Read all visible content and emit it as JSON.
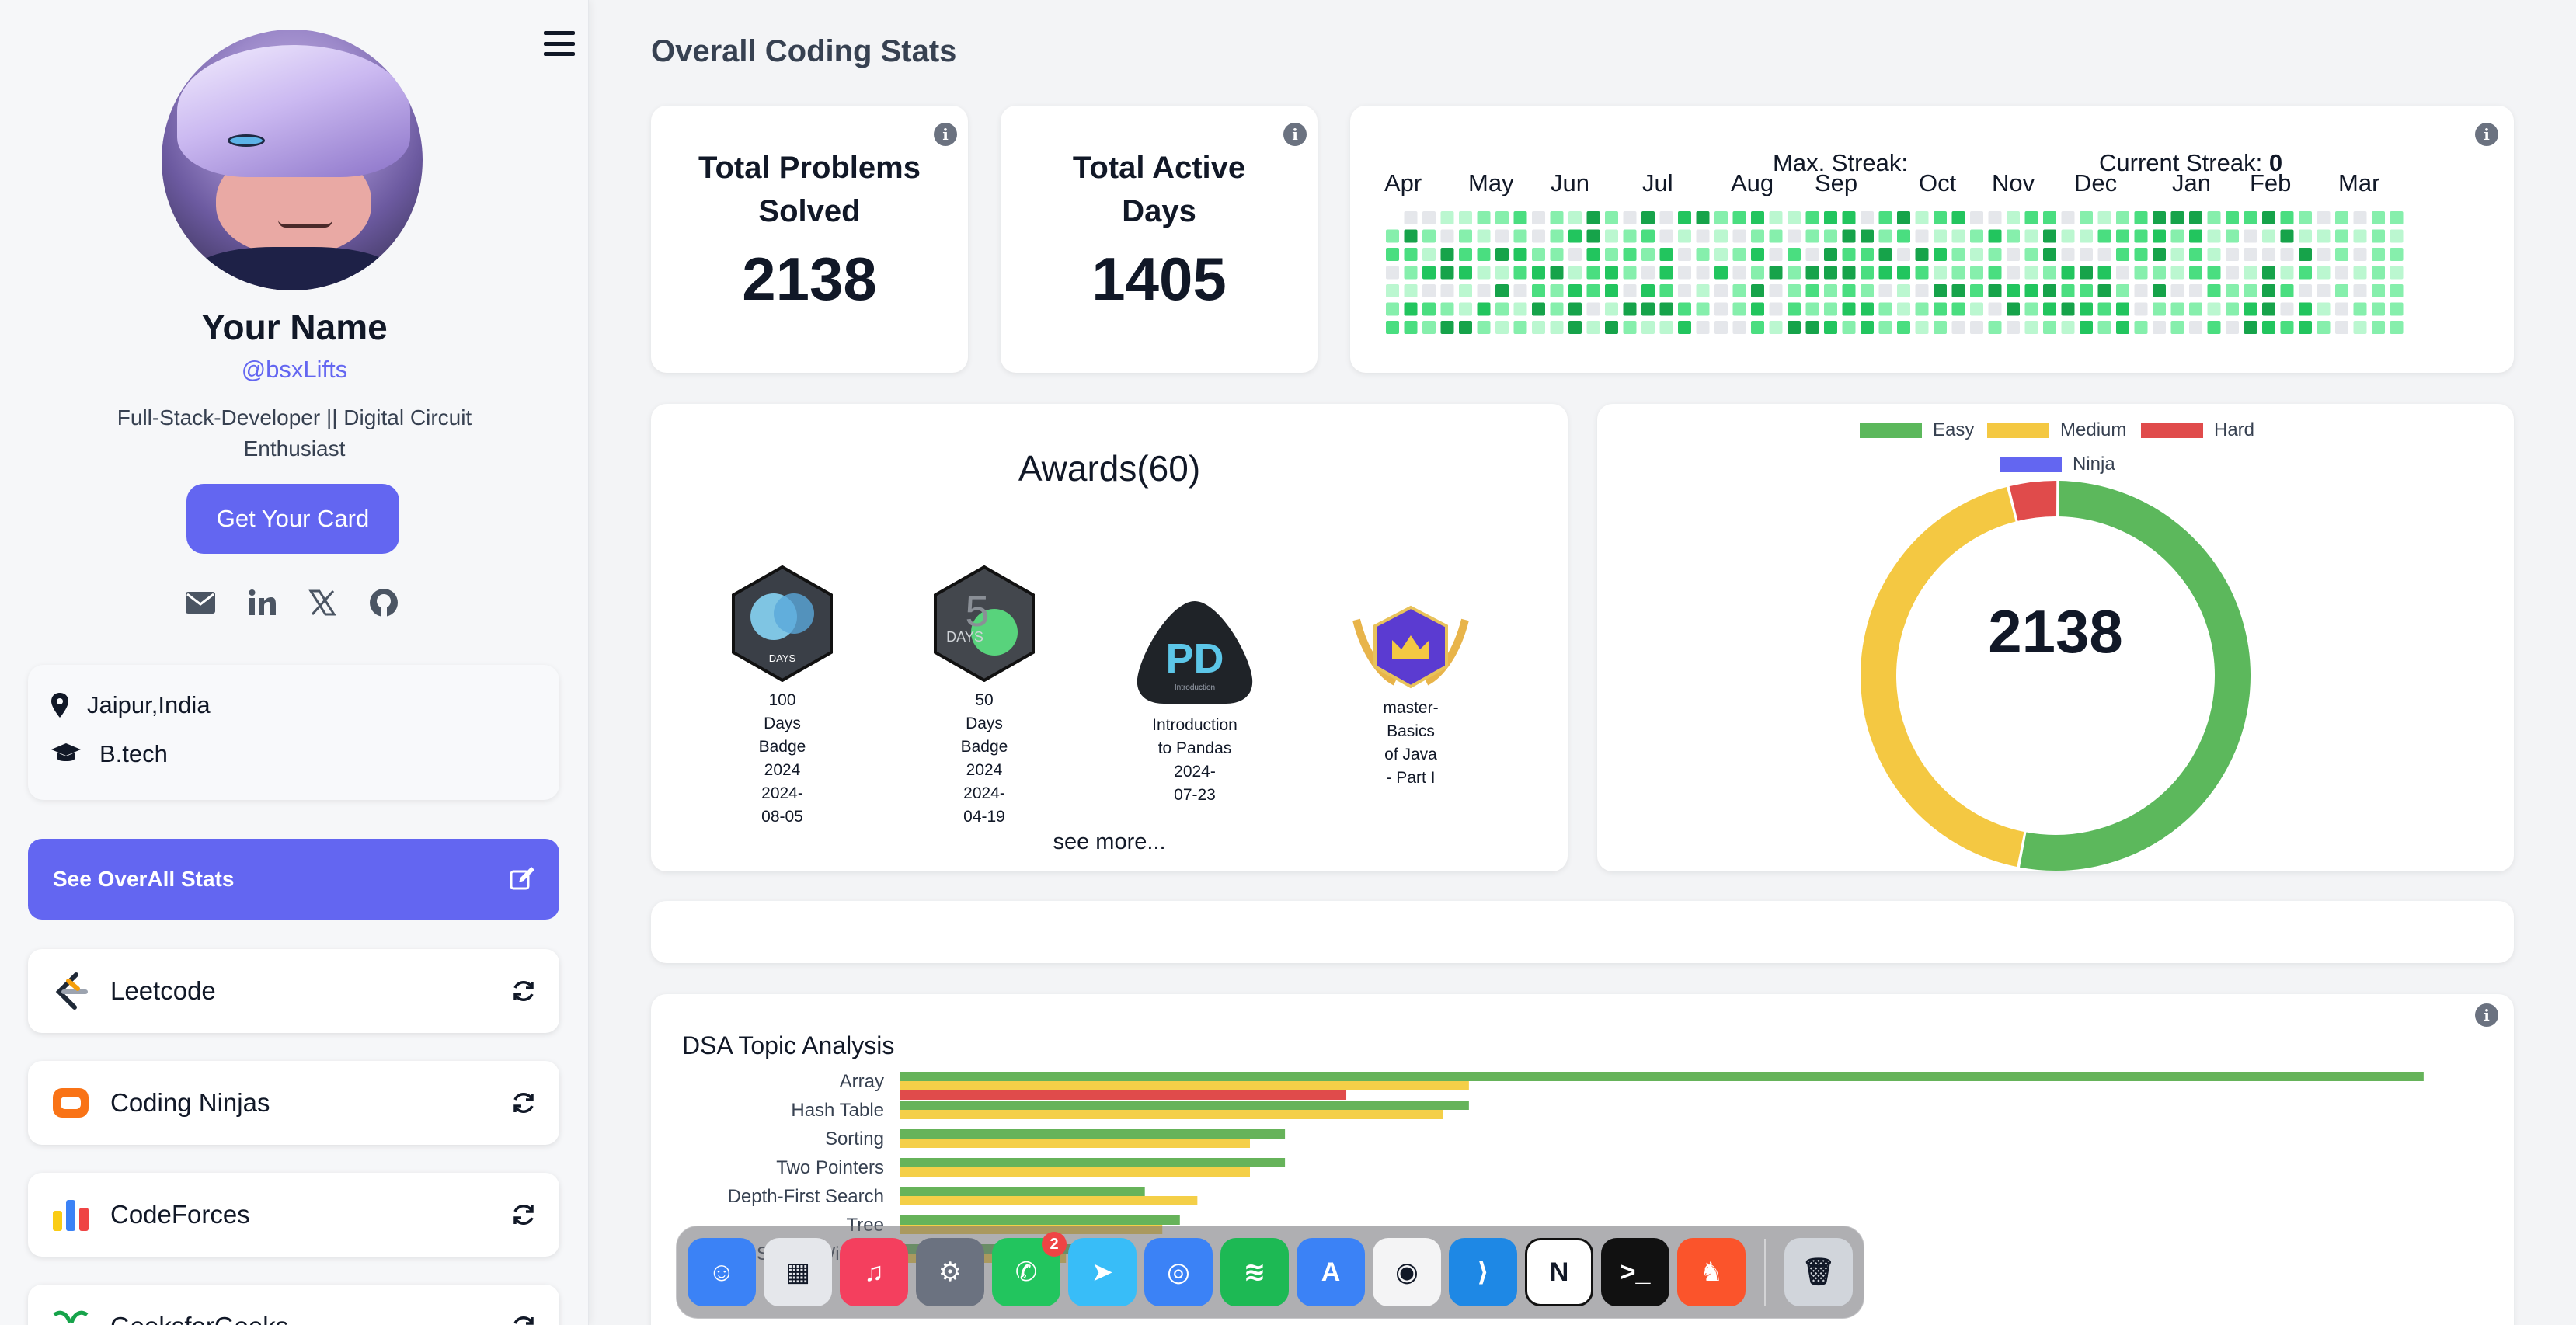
{
  "profile": {
    "name": "Your Name",
    "handle": "@bsxLifts",
    "bio": "Full-Stack-Developer || Digital Circuit Enthusiast",
    "get_card_label": "Get Your Card",
    "location": "Jaipur,India",
    "education": "B.tech",
    "socials": [
      "mail-icon",
      "linkedin-icon",
      "x-icon",
      "github-icon"
    ]
  },
  "sidebar": {
    "overall_stats_label": "See OverAll Stats",
    "platforms": [
      {
        "name": "Leetcode",
        "icon": "leetcode-icon"
      },
      {
        "name": "Coding Ninjas",
        "icon": "coding-ninjas-icon"
      },
      {
        "name": "CodeForces",
        "icon": "codeforces-icon"
      },
      {
        "name": "GeeksforGeeks",
        "icon": "geeksforgeeks-icon"
      }
    ]
  },
  "main": {
    "title": "Overall Coding Stats",
    "total_problems": {
      "label": "Total Problems Solved",
      "value": "2138"
    },
    "total_active_days": {
      "label": "Total Active Days",
      "value": "1405"
    },
    "streak": {
      "max_label": "Max. Streak:",
      "current_label": "Current Streak:",
      "current_value": "0"
    },
    "heatmap_months": [
      "Apr",
      "May",
      "Jun",
      "Jul",
      "Aug",
      "Sep",
      "Oct",
      "Nov",
      "Dec",
      "Jan",
      "Feb",
      "Mar"
    ],
    "awards": {
      "title": "Awards(60)",
      "items": [
        {
          "text": "100 Days Badge 2024 2024-08-05",
          "lines": [
            "100",
            "Days",
            "Badge",
            "2024",
            "2024-",
            "08-05"
          ]
        },
        {
          "text": "50 Days Badge 2024 2024-04-19",
          "lines": [
            "50",
            "Days",
            "Badge",
            "2024",
            "2024-",
            "04-19"
          ]
        },
        {
          "text": "Introduction to Pandas 2024-07-23",
          "lines": [
            "Introduction",
            "to Pandas",
            "2024-",
            "07-23"
          ]
        },
        {
          "text": "master-Basics of Java - Part I",
          "lines": [
            "master-",
            "Basics",
            "of Java",
            "- Part I"
          ]
        }
      ],
      "see_more": "see more..."
    },
    "difficulty_chart": {
      "center_value": "2138",
      "legend": [
        {
          "label": "Easy",
          "color": "#5cb85c"
        },
        {
          "label": "Medium",
          "color": "#f4c842"
        },
        {
          "label": "Hard",
          "color": "#e04b4b"
        },
        {
          "label": "Ninja",
          "color": "#6366f1"
        }
      ]
    },
    "dsa": {
      "title": "DSA Topic Analysis"
    }
  },
  "chart_data": [
    {
      "type": "pie",
      "title": "",
      "labels": [
        "Easy",
        "Medium",
        "Hard",
        "Ninja"
      ],
      "values": [
        1130,
        920,
        88,
        0
      ],
      "colors": [
        "#5cb85c",
        "#f4c842",
        "#e04b4b",
        "#6366f1"
      ]
    },
    {
      "type": "bar",
      "orientation": "horizontal",
      "title": "DSA Topic Analysis",
      "categories": [
        "Array",
        "Hash Table",
        "Sorting",
        "Two Pointers",
        "Depth-First Search",
        "Tree",
        "Sliding Window"
      ],
      "series": [
        {
          "name": "",
          "values": [
            870,
            325,
            220,
            220,
            140,
            160,
            100
          ]
        },
        {
          "name": "",
          "values": [
            325,
            310,
            200,
            200,
            170,
            150,
            95
          ]
        },
        {
          "name": "",
          "values": [
            255,
            0,
            0,
            0,
            0,
            0,
            0
          ]
        }
      ]
    }
  ],
  "dock": {
    "apps": [
      {
        "icon": "finder-icon",
        "color": "#3b82f6"
      },
      {
        "icon": "launchpad-icon",
        "color": "#e5e7eb"
      },
      {
        "icon": "music-icon",
        "color": "#f43f5e"
      },
      {
        "icon": "settings-icon",
        "color": "#6b7280"
      },
      {
        "icon": "whatsapp-icon",
        "color": "#22c55e",
        "badge": "2"
      },
      {
        "icon": "telegram-icon",
        "color": "#38bdf8"
      },
      {
        "icon": "safari-icon",
        "color": "#3b82f6"
      },
      {
        "icon": "spotify-icon",
        "color": "#1db954"
      },
      {
        "icon": "app-store-icon",
        "color": "#3b82f6"
      },
      {
        "icon": "chrome-icon",
        "color": "#f4f4f5"
      },
      {
        "icon": "vscode-icon",
        "color": "#1e88e5"
      },
      {
        "icon": "notion-icon",
        "color": "#ffffff"
      },
      {
        "icon": "terminal-icon",
        "color": "#111111"
      },
      {
        "icon": "brave-icon",
        "color": "#fb542b"
      },
      {
        "icon": "trash-icon",
        "color": "#d1d5db"
      }
    ]
  }
}
